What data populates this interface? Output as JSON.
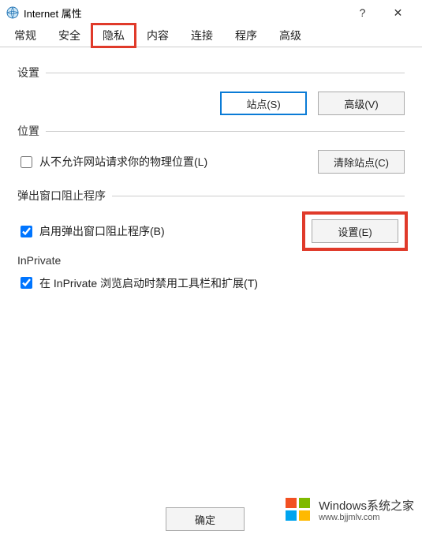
{
  "titlebar": {
    "title": "Internet 属性",
    "help_glyph": "?",
    "close_glyph": "✕"
  },
  "tabs": {
    "items": [
      {
        "label": "常规"
      },
      {
        "label": "安全"
      },
      {
        "label": "隐私"
      },
      {
        "label": "内容"
      },
      {
        "label": "连接"
      },
      {
        "label": "程序"
      },
      {
        "label": "高级"
      }
    ],
    "active_index": 2
  },
  "settings": {
    "label": "设置",
    "sites_btn": "站点(S)",
    "advanced_btn": "高级(V)"
  },
  "location": {
    "label": "位置",
    "checkbox_label": "从不允许网站请求你的物理位置(L)",
    "checkbox_checked": false,
    "clear_btn": "清除站点(C)"
  },
  "popup": {
    "label": "弹出窗口阻止程序",
    "checkbox_label": "启用弹出窗口阻止程序(B)",
    "checkbox_checked": true,
    "settings_btn": "设置(E)"
  },
  "inprivate": {
    "label": "InPrivate",
    "checkbox_label": "在 InPrivate 浏览启动时禁用工具栏和扩展(T)",
    "checkbox_checked": true
  },
  "buttons": {
    "ok": "确定"
  },
  "watermark": {
    "brand": "Windows",
    "cn": "系统之家",
    "url": "www.bjjmlv.com"
  }
}
